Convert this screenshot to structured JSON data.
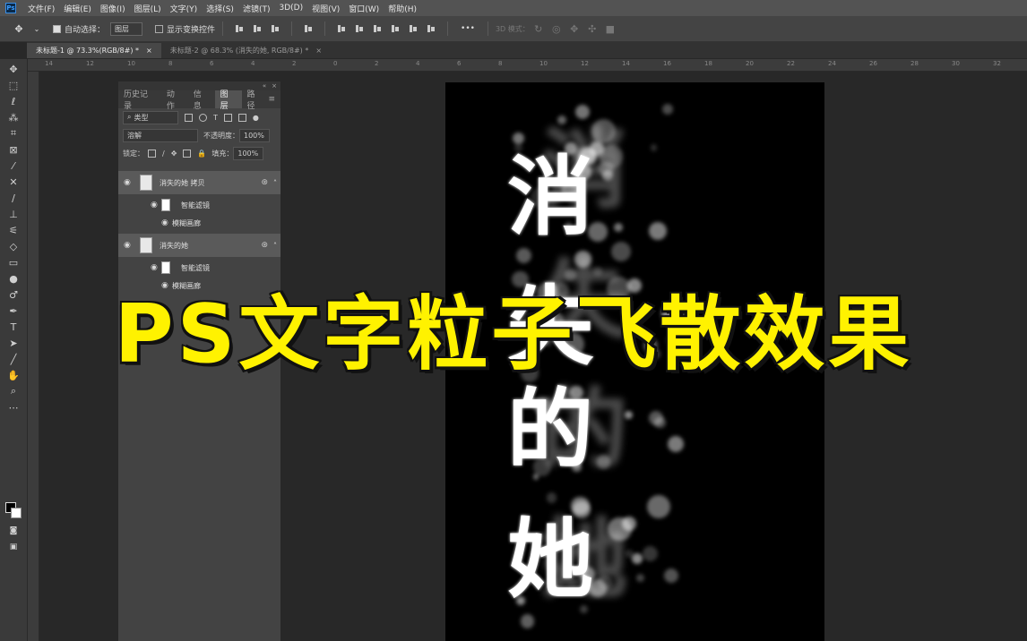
{
  "menubar": {
    "logo": "Ps",
    "items": [
      "文件(F)",
      "编辑(E)",
      "图像(I)",
      "图层(L)",
      "文字(Y)",
      "选择(S)",
      "滤镜(T)",
      "3D(D)",
      "视图(V)",
      "窗口(W)",
      "帮助(H)"
    ]
  },
  "options": {
    "auto_select_label": "自动选择：",
    "auto_select_value": "图层",
    "show_transform_label": "显示变换控件",
    "more": "•••",
    "mode_3d_label": "3D 模式："
  },
  "tabs": [
    {
      "label": "未标题-1 @ 73.3%(RGB/8#) *",
      "close": "×"
    },
    {
      "label": "未标题-2 @ 68.3% (消失的她, RGB/8#) *",
      "close": "×"
    }
  ],
  "ruler_ticks": [
    "14",
    "12",
    "10",
    "8",
    "6",
    "4",
    "2",
    "0",
    "2",
    "4",
    "6",
    "8",
    "10",
    "12",
    "14",
    "16",
    "18",
    "20",
    "22",
    "24",
    "26",
    "28",
    "30",
    "32"
  ],
  "layers_panel": {
    "tabs": [
      "历史记录",
      "动作",
      "信息",
      "图层",
      "路径"
    ],
    "active_tab": "图层",
    "filter_kind": "类型",
    "blend_mode": "溶解",
    "opacity_label": "不透明度：",
    "opacity_value": "100%",
    "lock_label": "锁定：",
    "fill_label": "填充：",
    "fill_value": "100%",
    "layers": [
      {
        "name": "消失的她 拷贝"
      },
      {
        "name": "智能滤镜"
      },
      {
        "name": "模糊画廊"
      },
      {
        "name": "消失的她"
      },
      {
        "name": "智能滤镜"
      },
      {
        "name": "模糊画廊"
      }
    ]
  },
  "canvas": {
    "chars": [
      "消",
      "失",
      "的",
      "她"
    ]
  },
  "overlay_title": "PS文字粒子飞散效果"
}
